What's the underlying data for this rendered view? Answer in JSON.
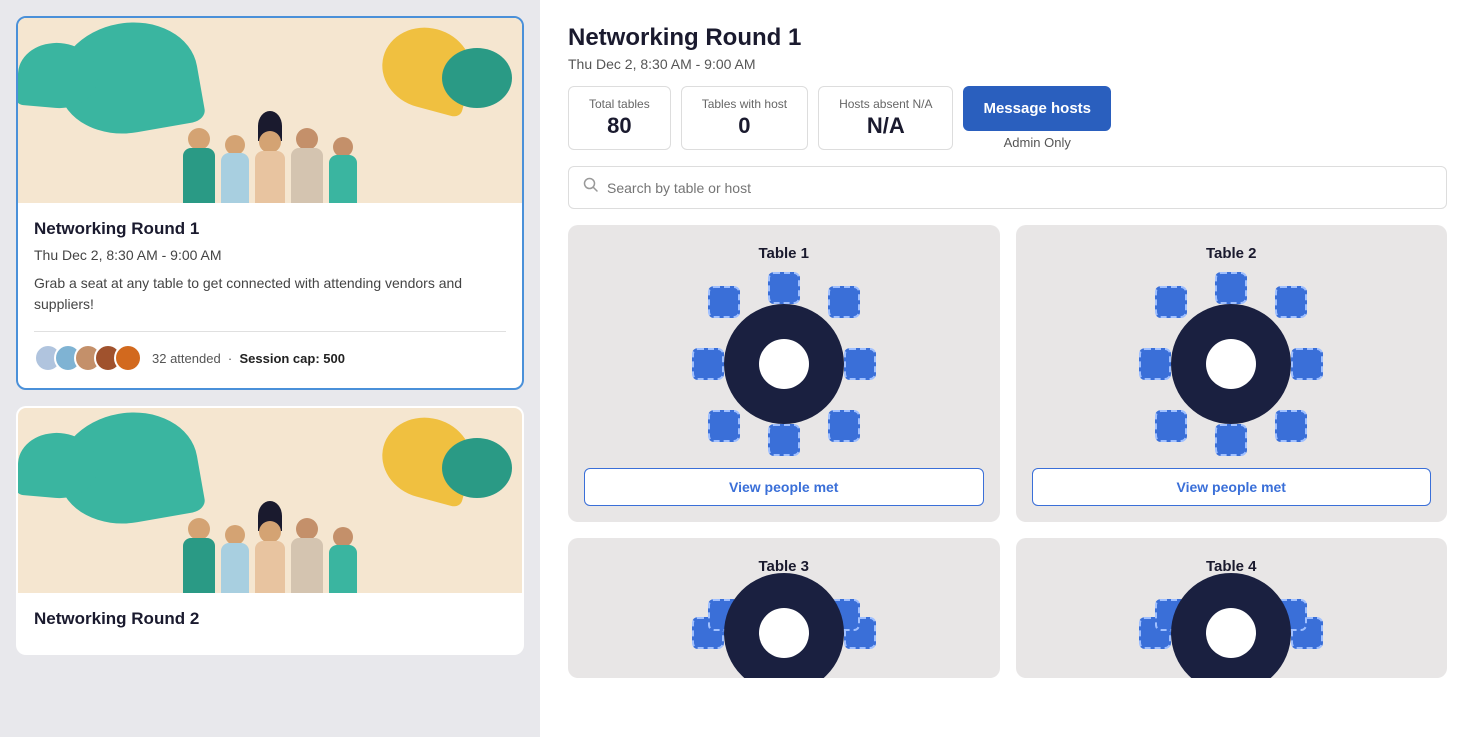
{
  "leftPanel": {
    "cards": [
      {
        "id": "round1",
        "title": "Networking Round 1",
        "time": "Thu Dec 2, 8:30 AM - 9:00 AM",
        "description": "Grab a seat at any table to get connected with attending vendors and suppliers!",
        "attended": "32 attended",
        "sessionCap": "Session cap: 500",
        "active": true
      },
      {
        "id": "round2",
        "title": "Networking Round 2",
        "time": "",
        "description": "",
        "attended": "",
        "sessionCap": "",
        "active": false
      }
    ]
  },
  "rightPanel": {
    "title": "Networking Round 1",
    "datetime": "Thu Dec 2, 8:30 AM - 9:00 AM",
    "stats": {
      "totalTables": {
        "label": "Total tables",
        "value": "80"
      },
      "tablesWithHost": {
        "label": "Tables with host",
        "value": "0"
      },
      "hostsAbsent": {
        "label": "Hosts absent N/A",
        "value": "N/A"
      }
    },
    "messageHostsBtn": "Message hosts",
    "adminOnly": "Admin Only",
    "search": {
      "placeholder": "Search by table or host"
    },
    "tables": [
      {
        "id": 1,
        "label": "Table 1",
        "viewBtn": "View people met"
      },
      {
        "id": 2,
        "label": "Table 2",
        "viewBtn": "View people met"
      },
      {
        "id": 3,
        "label": "Table 3",
        "viewBtn": ""
      },
      {
        "id": 4,
        "label": "Table 4",
        "viewBtn": ""
      }
    ]
  }
}
